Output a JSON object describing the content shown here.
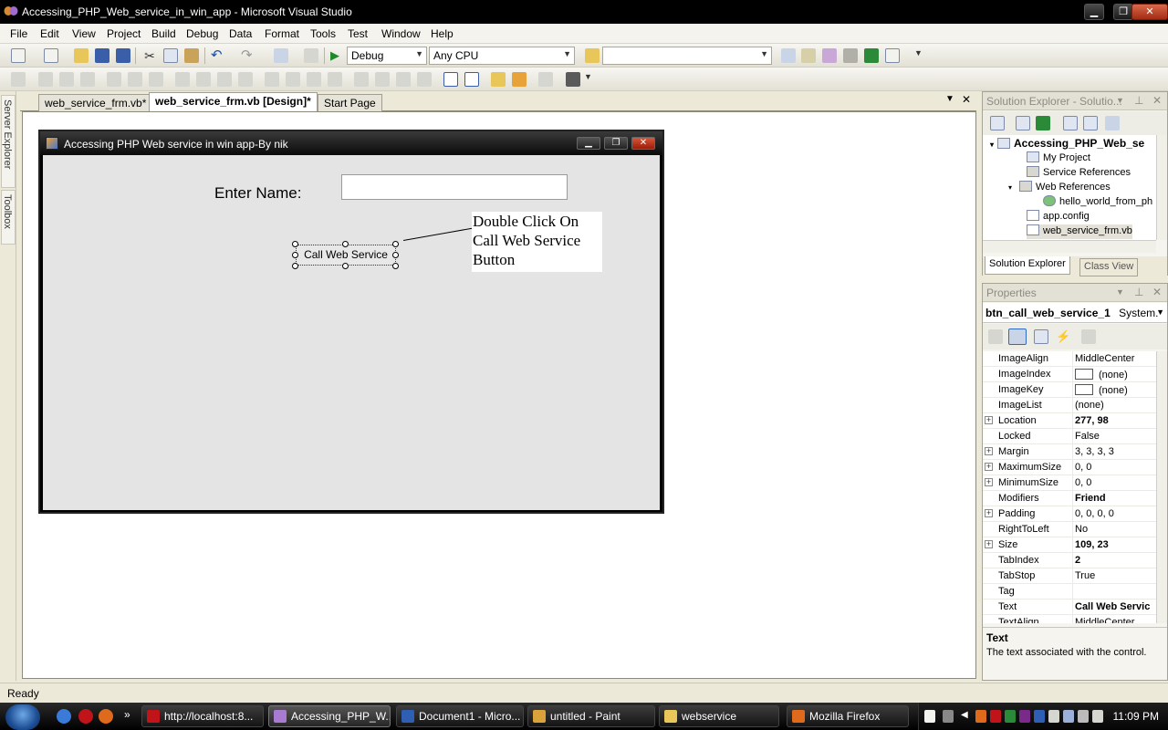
{
  "window": {
    "title": "Accessing_PHP_Web_service_in_win_app - Microsoft Visual Studio",
    "minimize": "▁",
    "restore": "❐",
    "close": "✕"
  },
  "menu": [
    "File",
    "Edit",
    "View",
    "Project",
    "Build",
    "Debug",
    "Data",
    "Format",
    "Tools",
    "Test",
    "Window",
    "Help"
  ],
  "toolbar": {
    "config": "Debug",
    "platform": "Any CPU",
    "find_value": ""
  },
  "left_strip": {
    "server_explorer": "Server Explorer",
    "toolbox": "Toolbox"
  },
  "tabs": [
    {
      "label": "web_service_frm.vb*"
    },
    {
      "label": "web_service_frm.vb [Design]*"
    },
    {
      "label": "Start Page"
    }
  ],
  "tabs_close": "✕",
  "designer_form": {
    "title": "Accessing PHP Web service in win app-By nik",
    "label": "Enter Name:",
    "textbox_value": "",
    "button": "Call Web Service",
    "callout": [
      "Double Click On",
      "Call Web Service",
      "Button"
    ]
  },
  "solution_explorer": {
    "title": "Solution Explorer - Solutio...",
    "root": "Accessing_PHP_Web_se",
    "items": [
      "My Project",
      "Service References",
      "Web References",
      "hello_world_from_ph",
      "app.config",
      "web_service_frm.vb"
    ],
    "tabs": [
      "Solution Explorer",
      "Class View"
    ]
  },
  "properties": {
    "title": "Properties",
    "selected_object": "btn_call_web_service_1",
    "selected_type": "System.",
    "rows": [
      {
        "name": "ImageAlign",
        "value": "MiddleCenter",
        "expand": false,
        "bold": false,
        "swatch": false
      },
      {
        "name": "ImageIndex",
        "value": "(none)",
        "expand": false,
        "bold": false,
        "swatch": true
      },
      {
        "name": "ImageKey",
        "value": "(none)",
        "expand": false,
        "bold": false,
        "swatch": true
      },
      {
        "name": "ImageList",
        "value": "(none)",
        "expand": false,
        "bold": false,
        "swatch": false
      },
      {
        "name": "Location",
        "value": "277, 98",
        "expand": true,
        "bold": true,
        "swatch": false
      },
      {
        "name": "Locked",
        "value": "False",
        "expand": false,
        "bold": false,
        "swatch": false
      },
      {
        "name": "Margin",
        "value": "3, 3, 3, 3",
        "expand": true,
        "bold": false,
        "swatch": false
      },
      {
        "name": "MaximumSize",
        "value": "0, 0",
        "expand": true,
        "bold": false,
        "swatch": false
      },
      {
        "name": "MinimumSize",
        "value": "0, 0",
        "expand": true,
        "bold": false,
        "swatch": false
      },
      {
        "name": "Modifiers",
        "value": "Friend",
        "expand": false,
        "bold": true,
        "swatch": false
      },
      {
        "name": "Padding",
        "value": "0, 0, 0, 0",
        "expand": true,
        "bold": false,
        "swatch": false
      },
      {
        "name": "RightToLeft",
        "value": "No",
        "expand": false,
        "bold": false,
        "swatch": false
      },
      {
        "name": "Size",
        "value": "109, 23",
        "expand": true,
        "bold": true,
        "swatch": false
      },
      {
        "name": "TabIndex",
        "value": "2",
        "expand": false,
        "bold": true,
        "swatch": false
      },
      {
        "name": "TabStop",
        "value": "True",
        "expand": false,
        "bold": false,
        "swatch": false
      },
      {
        "name": "Tag",
        "value": "",
        "expand": false,
        "bold": false,
        "swatch": false
      },
      {
        "name": "Text",
        "value": "Call Web Servic",
        "expand": false,
        "bold": true,
        "swatch": false
      },
      {
        "name": "TextAlign",
        "value": "MiddleCenter",
        "expand": false,
        "bold": false,
        "swatch": false
      }
    ],
    "description_title": "Text",
    "description": "The text associated with the control."
  },
  "status": "Ready",
  "taskbar": {
    "items": [
      {
        "label": "http://localhost:8...",
        "color": "#c0141a"
      },
      {
        "label": "Accessing_PHP_W...",
        "color": "#a97bd0"
      },
      {
        "label": "Document1 - Micro...",
        "color": "#2f5fb3"
      },
      {
        "label": "untitled - Paint",
        "color": "#d9a23a"
      },
      {
        "label": "webservice",
        "color": "#e8c65a"
      },
      {
        "label": "Mozilla Firefox",
        "color": "#e06a1c"
      }
    ],
    "clock": "11:09 PM",
    "more": "»"
  },
  "colors": {
    "accent": "#316ac5",
    "form_body": "#e4e4e4",
    "chrome": "#ece9d8"
  }
}
